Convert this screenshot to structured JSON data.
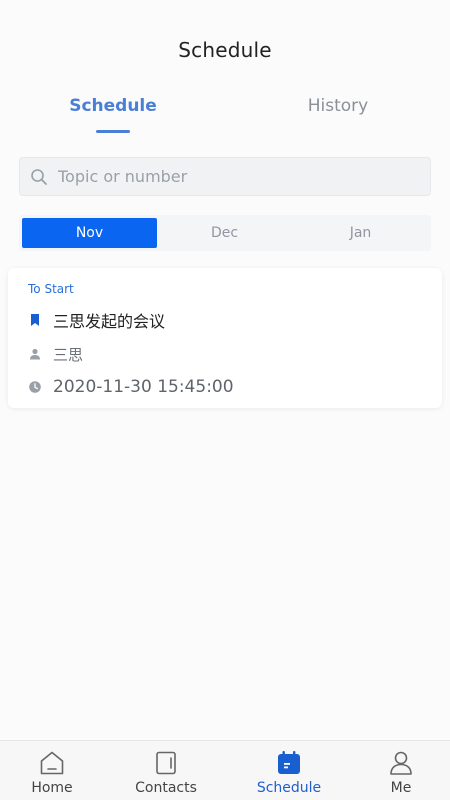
{
  "header": {
    "title": "Schedule"
  },
  "tabs": [
    {
      "label": "Schedule",
      "active": true
    },
    {
      "label": "History",
      "active": false
    }
  ],
  "search": {
    "placeholder": "Topic or number",
    "value": ""
  },
  "months": [
    {
      "label": "Nov",
      "active": true
    },
    {
      "label": "Dec",
      "active": false
    },
    {
      "label": "Jan",
      "active": false
    }
  ],
  "meeting": {
    "status": "To Start",
    "topic": "三思发起的会议",
    "host": "三思",
    "time": "2020-11-30 15:45:00"
  },
  "tabbar": [
    {
      "label": "Home",
      "icon": "home-icon",
      "active": false
    },
    {
      "label": "Contacts",
      "icon": "contacts-icon",
      "active": false
    },
    {
      "label": "Schedule",
      "icon": "calendar-icon",
      "active": true
    },
    {
      "label": "Me",
      "icon": "person-icon",
      "active": false
    }
  ],
  "colors": {
    "accent": "#4a7fd6",
    "active_month": "#0a66f0",
    "tabbar_active": "#1f5fcf",
    "status": "#2a6fd6"
  }
}
